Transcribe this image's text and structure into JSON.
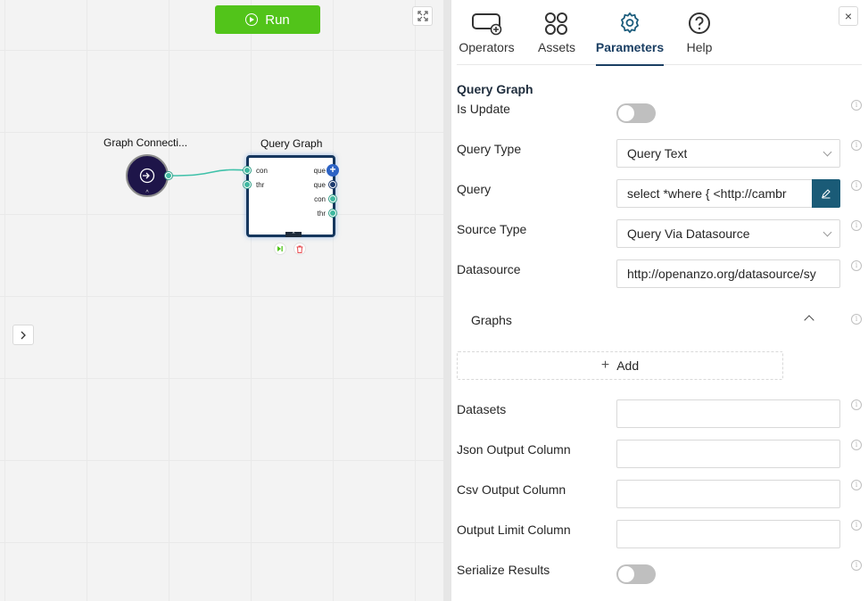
{
  "canvas": {
    "run_label": "Run",
    "nodes": {
      "graph_connection": {
        "title": "Graph Connecti..."
      },
      "query_graph": {
        "title": "Query Graph",
        "inputs": [
          "con",
          "thr"
        ],
        "outputs": [
          "que",
          "que",
          "con",
          "thr"
        ]
      }
    }
  },
  "panel": {
    "tabs": [
      {
        "label": "Operators",
        "icon": "operators-icon"
      },
      {
        "label": "Assets",
        "icon": "assets-grid-icon"
      },
      {
        "label": "Parameters",
        "icon": "gear-icon",
        "active": true
      },
      {
        "label": "Help",
        "icon": "help-icon"
      }
    ],
    "section_title": "Query Graph",
    "fields": {
      "is_update": {
        "label": "Is Update",
        "value": false
      },
      "query_type": {
        "label": "Query Type",
        "value": "Query Text"
      },
      "query": {
        "label": "Query",
        "value": "select *where {  <http://cambr"
      },
      "source_type": {
        "label": "Source Type",
        "value": "Query Via Datasource"
      },
      "datasource": {
        "label": "Datasource",
        "value": "http://openanzo.org/datasource/sy"
      },
      "graphs": {
        "label": "Graphs",
        "add_label": "Add"
      },
      "datasets": {
        "label": "Datasets",
        "value": ""
      },
      "json_output_column": {
        "label": "Json Output Column",
        "value": ""
      },
      "csv_output_column": {
        "label": "Csv Output Column",
        "value": ""
      },
      "output_limit_column": {
        "label": "Output Limit Column",
        "value": ""
      },
      "serialize_results": {
        "label": "Serialize Results",
        "value": false
      }
    }
  },
  "colors": {
    "run_green": "#52c41a",
    "accent_navy": "#1b3f63",
    "edit_teal": "#1a5b77",
    "port_teal": "#3fb8a0",
    "node_dark": "#1e1549"
  }
}
